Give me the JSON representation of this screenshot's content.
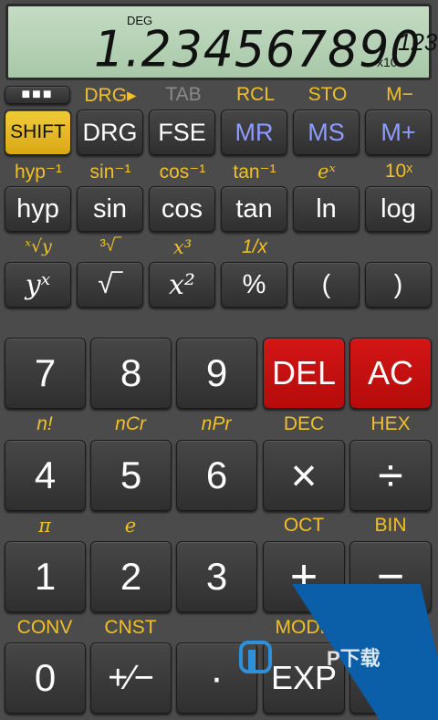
{
  "display": {
    "mode": "DEG",
    "number": "1.234567890",
    "x10": "x10",
    "exponent": "123"
  },
  "top_labels": [
    "DRG▸",
    "TAB",
    "RCL",
    "STO",
    "M−"
  ],
  "row1": [
    "SHIFT",
    "DRG",
    "FSE",
    "MR",
    "MS",
    "M+"
  ],
  "labels2": [
    "hyp⁻¹",
    "sin⁻¹",
    "cos⁻¹",
    "tan⁻¹",
    "eˣ",
    "10ˣ"
  ],
  "row2": [
    "hyp",
    "sin",
    "cos",
    "tan",
    "ln",
    "log"
  ],
  "labels3": [
    "ˣ√y",
    "³√‾",
    "x³",
    "1/x"
  ],
  "row3": [
    "yˣ",
    "√‾",
    "x²",
    "%",
    "(",
    ")"
  ],
  "row4": [
    "7",
    "8",
    "9",
    "DEL",
    "AC"
  ],
  "labels5": [
    "n!",
    "nCr",
    "nPr",
    "DEC",
    "HEX"
  ],
  "row5": [
    "4",
    "5",
    "6",
    "×",
    "÷"
  ],
  "labels6": [
    "π",
    "e",
    "",
    "OCT",
    "BIN"
  ],
  "row6": [
    "1",
    "2",
    "3",
    "+",
    "−"
  ],
  "labels7": [
    "CONV",
    "CNST",
    "",
    "MODE",
    ""
  ],
  "row7": [
    "0",
    "+∕−",
    "·",
    "EXP",
    ""
  ],
  "watermark": "P下载",
  "colors": {
    "accent_label": "#f0c028",
    "shift": "#e8be2a",
    "delete": "#cc1010",
    "memory": "#8e9cff",
    "lcd": "#b4d4b4"
  }
}
